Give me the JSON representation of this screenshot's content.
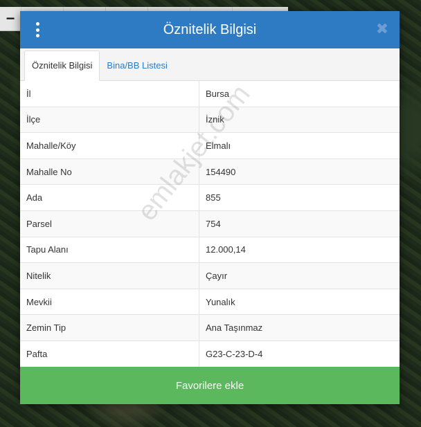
{
  "toolbar": {
    "zoom_out_glyph": "−"
  },
  "modal": {
    "title": "Öznitelik Bilgisi",
    "tabs": [
      {
        "label": "Öznitelik Bilgisi",
        "active": true
      },
      {
        "label": "Bina/BB Listesi",
        "active": false
      }
    ],
    "rows": [
      {
        "key": "İl",
        "value": "Bursa"
      },
      {
        "key": "İlçe",
        "value": "İznik"
      },
      {
        "key": "Mahalle/Köy",
        "value": "Elmalı"
      },
      {
        "key": "Mahalle No",
        "value": "154490"
      },
      {
        "key": "Ada",
        "value": "855"
      },
      {
        "key": "Parsel",
        "value": "754"
      },
      {
        "key": "Tapu Alanı",
        "value": "12.000,14"
      },
      {
        "key": "Nitelik",
        "value": "Çayır"
      },
      {
        "key": "Mevkii",
        "value": "Yunalık"
      },
      {
        "key": "Zemin Tip",
        "value": "Ana Taşınmaz"
      },
      {
        "key": "Pafta",
        "value": "G23-C-23-D-4"
      }
    ],
    "favorite_button": "Favorilere ekle",
    "close_glyph": "✖"
  },
  "watermark": "emlakjet.com",
  "colors": {
    "header": "#2e7bc4",
    "button": "#5cb85c",
    "tab_link": "#2e7bc4"
  }
}
